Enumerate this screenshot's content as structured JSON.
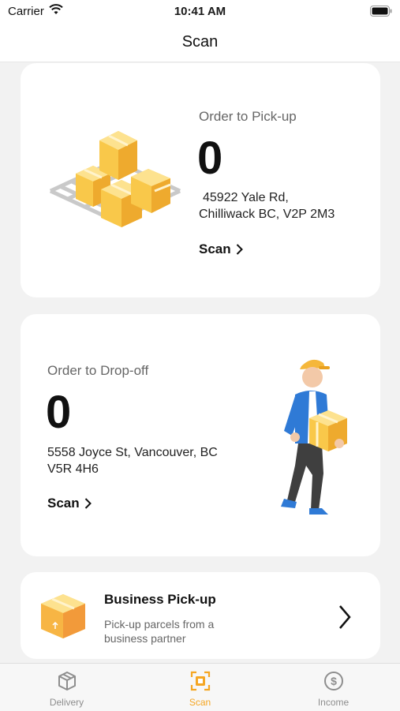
{
  "status_bar": {
    "carrier": "Carrier",
    "time": "10:41 AM"
  },
  "nav": {
    "title": "Scan"
  },
  "pickup": {
    "label": "Order to Pick-up",
    "count": "0",
    "address_line1": "45922 Yale Rd,",
    "address_line2": "Chilliwack BC, V2P 2M3",
    "scan_label": "Scan"
  },
  "dropoff": {
    "label": "Order to Drop-off",
    "count": "0",
    "address_line1": "5558 Joyce St, Vancouver, BC",
    "address_line2": "V5R 4H6",
    "scan_label": "Scan"
  },
  "business": {
    "title": "Business Pick-up",
    "description": "Pick-up parcels from a business partner"
  },
  "tabs": [
    {
      "label": "Delivery",
      "icon": "box-icon",
      "active": false
    },
    {
      "label": "Scan",
      "icon": "scan-icon",
      "active": true
    },
    {
      "label": "Income",
      "icon": "dollar-icon",
      "active": false
    }
  ],
  "colors": {
    "accent": "#f5a623",
    "inactive": "#8e8e8e",
    "box_yellow": "#f9c84a"
  }
}
